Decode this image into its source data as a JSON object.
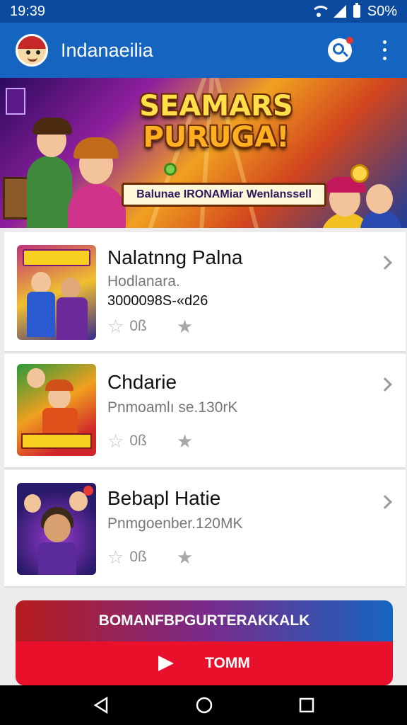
{
  "status_bar": {
    "time": "19:39",
    "battery_text": "S0%"
  },
  "app_bar": {
    "title": "Indanaeilia",
    "icons": [
      "avatar",
      "search-icon",
      "more-vert-icon"
    ]
  },
  "banner": {
    "title_line1": "SEAMARS",
    "title_line2": "PURUGA!",
    "subtitle": "Balunae IRONAMiar Wenlanssell"
  },
  "games": [
    {
      "title": "Nalatnng Palna",
      "subtitle": "Hodlanara.",
      "extra": "3000098S-«d26",
      "rating": "0ß"
    },
    {
      "title": "Chdarie",
      "subtitle": "Pnmoamlı se.130rK",
      "rating": "0ß"
    },
    {
      "title": "Bebapl Hatie",
      "subtitle": "Pnmgoenber.120MK",
      "rating": "0ß"
    }
  ],
  "cta": {
    "top_label": "BOMANFBPGURTERAKKALK",
    "button_label": "TOMM"
  },
  "colors": {
    "primary": "#1565c0",
    "status": "#0b4a9e",
    "cta_red": "#e8102a"
  }
}
